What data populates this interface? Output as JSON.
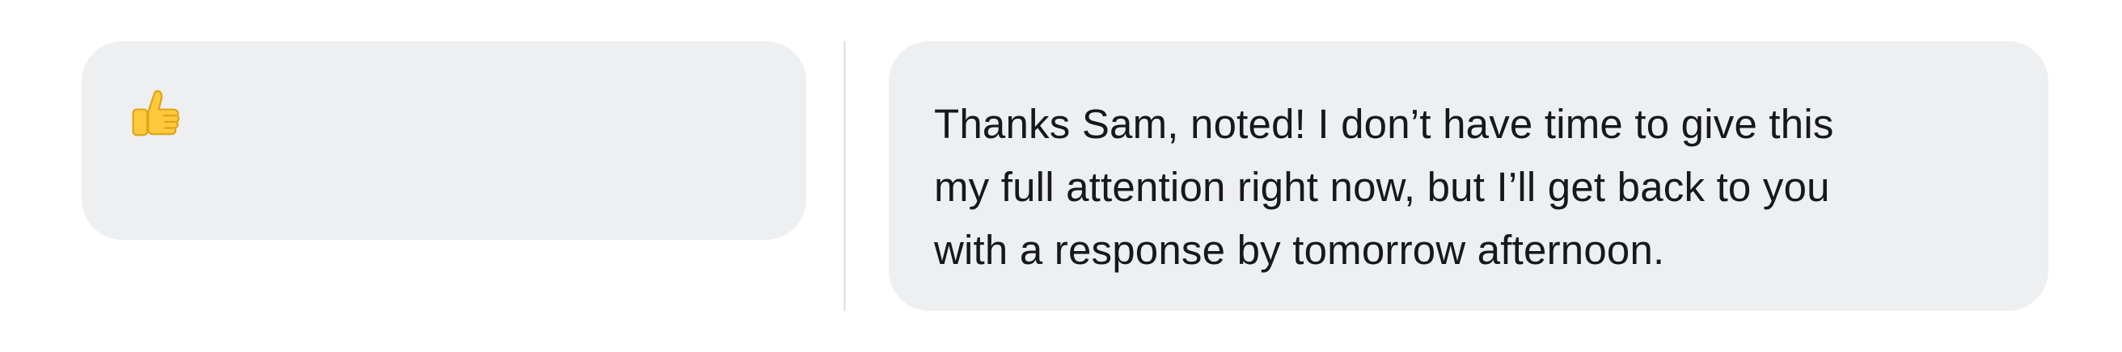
{
  "messages": [
    {
      "type": "emoji",
      "emoji_icon": "thumbs-up-icon"
    },
    {
      "type": "text",
      "text": "Thanks Sam, noted! I don’t have time to give this\nmy full attention right now, but I’ll get back to you\nwith a response by tomorrow afternoon."
    }
  ],
  "colors": {
    "bubble_background": "#eeeff1",
    "text": "#16181d",
    "divider": "#e6e7ea",
    "thumb_yellow": "#ffc83d"
  }
}
